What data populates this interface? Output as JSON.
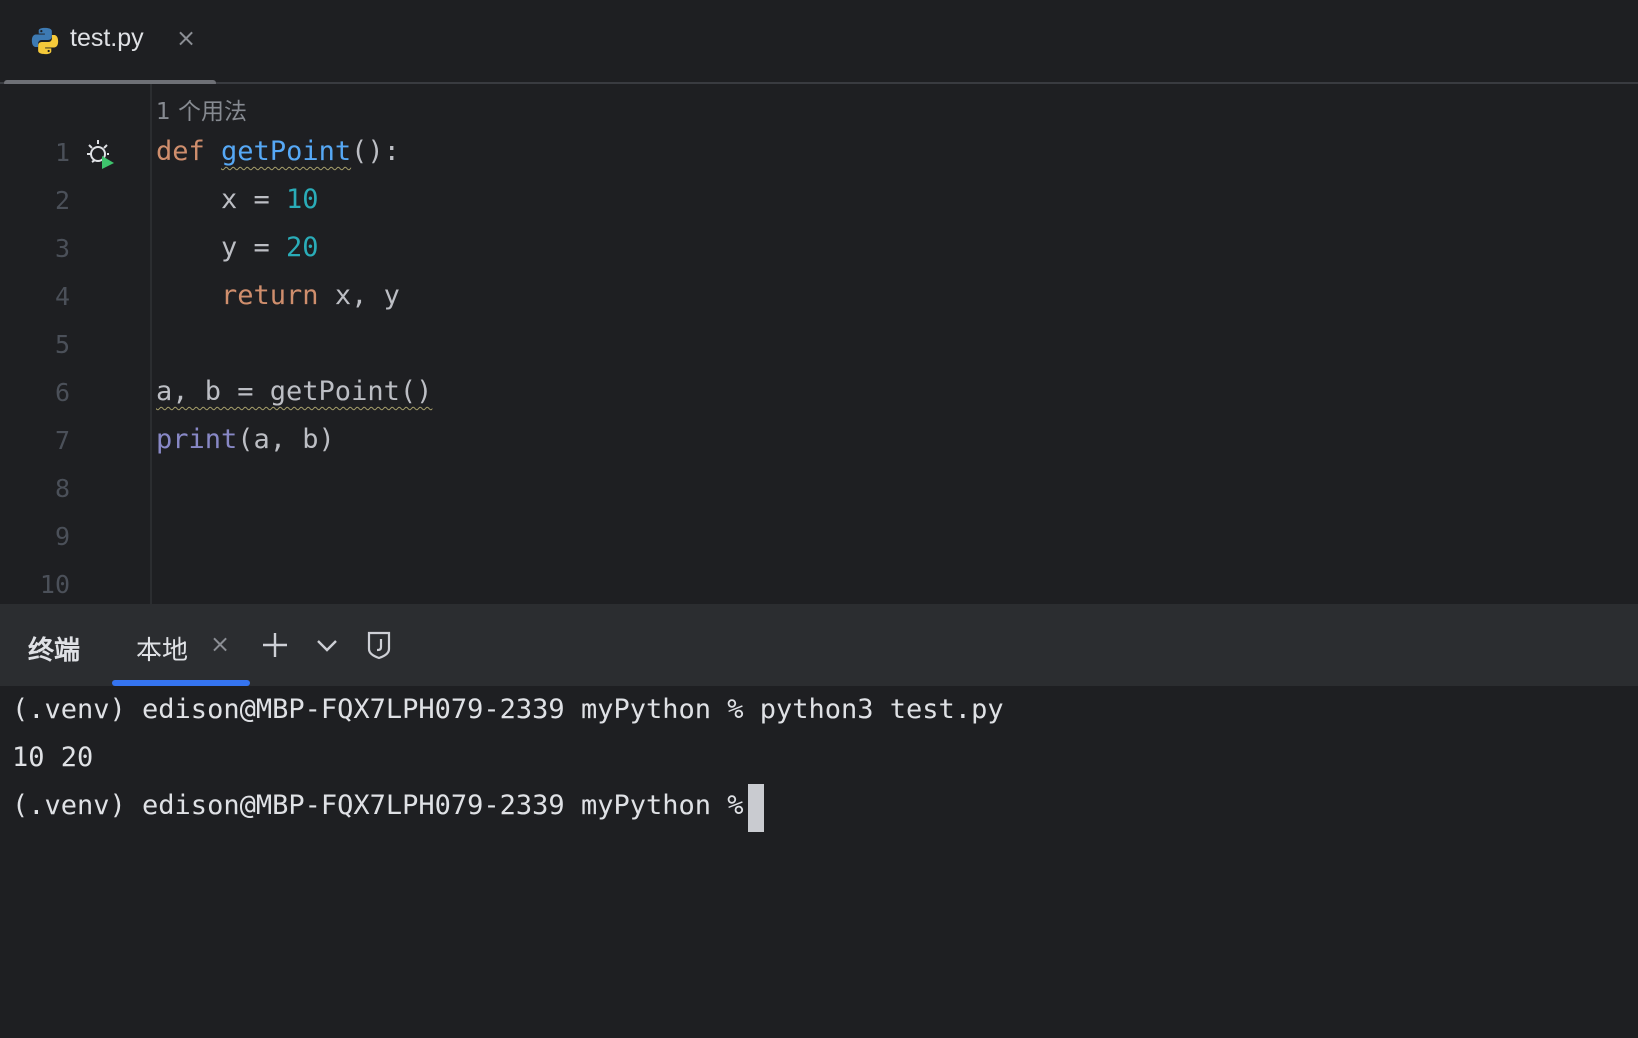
{
  "tab": {
    "filename": "test.py",
    "close_glyph": "×",
    "icon": "python-icon"
  },
  "editor": {
    "usage_hint": "1 个用法",
    "line_numbers": [
      "1",
      "2",
      "3",
      "4",
      "5",
      "6",
      "7",
      "8",
      "9",
      "10"
    ],
    "lines": [
      "def getPoint():",
      "    x = 10",
      "    y = 20",
      "    return x, y",
      "",
      "a, b = getPoint()",
      "print(a, b)",
      "",
      "",
      ""
    ],
    "line1": {
      "kw": "def",
      "fn": "getPoint",
      "rest": "():"
    },
    "line2": {
      "pre": "    x = ",
      "num": "10"
    },
    "line3": {
      "pre": "    y = ",
      "num": "20"
    },
    "line4": {
      "kw": "    return",
      "rest": " x, y"
    },
    "line6": {
      "text": "a, b = getPoint()"
    },
    "line7": {
      "bi": "print",
      "rest": "(a, b)"
    }
  },
  "terminal": {
    "title": "终端",
    "tab_label": "本地",
    "close_glyph": "×",
    "output": [
      "(.venv) edison@MBP-FQX7LPH079-2339 myPython % python3 test.py",
      "10 20",
      "(.venv) edison@MBP-FQX7LPH079-2339 myPython % "
    ]
  },
  "colors": {
    "background": "#1e1f22",
    "keyword": "#cf8e6d",
    "function": "#56a8f5",
    "number": "#2aacb8",
    "builtin": "#8888c6",
    "accent": "#3574f0"
  }
}
